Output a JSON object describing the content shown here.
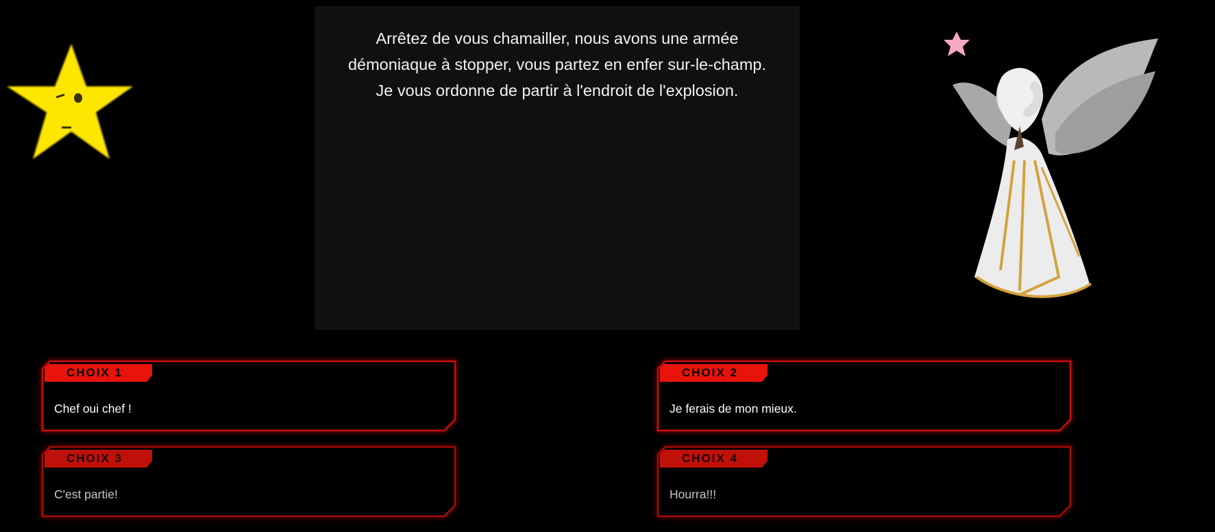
{
  "dialog": {
    "lines": [
      "Arrêtez de vous chamailler, nous avons une armée",
      "démoniaque à stopper, vous partez en enfer sur-le-champ.",
      "Je vous ordonne de partir à l'endroit de l'explosion."
    ]
  },
  "characters": {
    "left": {
      "icon": "star-character-icon",
      "color": "#ffe600"
    },
    "right": {
      "icon": "angel-character-icon",
      "color": "#e8e8e8"
    }
  },
  "choices": [
    {
      "tag": "CHOIX 1",
      "text": "Chef oui chef !"
    },
    {
      "tag": "CHOIX 2",
      "text": "Je ferais de mon mieux."
    },
    {
      "tag": "CHOIX 3",
      "text": "C'est partie!"
    },
    {
      "tag": "CHOIX 4",
      "text": "Hourra!!!"
    }
  ],
  "colors": {
    "background": "#000000",
    "dialog_bg": "#0f110e",
    "accent_red": "#e8140c",
    "frame_red": "#c8100a"
  }
}
